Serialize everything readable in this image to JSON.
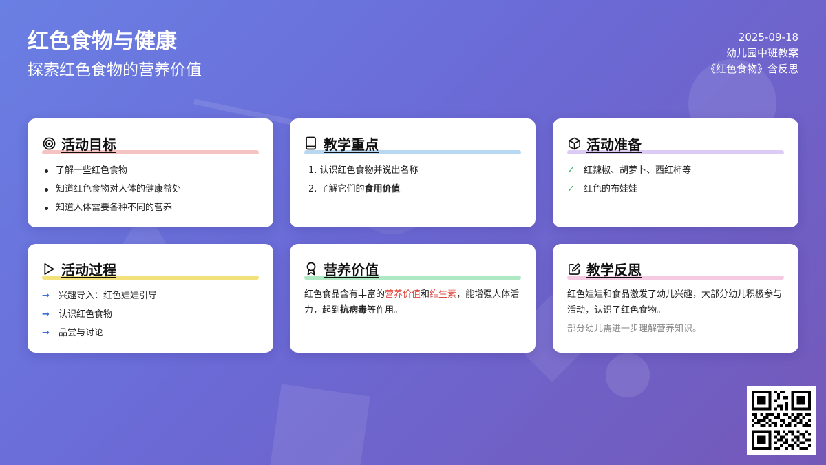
{
  "header": {
    "title": "红色食物与健康",
    "subtitle": "探索红色食物的营养价值",
    "date": "2025-09-18",
    "class_name": "幼儿园中班教案",
    "doc_name": "《红色食物》含反思"
  },
  "colors": {
    "bg_start": "#6a7fe3",
    "bg_end": "#7458b8",
    "highlight_red": "#f6c3c3",
    "highlight_blue": "#b8d7f0",
    "highlight_purple": "#dccbf4",
    "highlight_yellow": "#f3e27b",
    "highlight_green": "#aee9c4",
    "highlight_pink": "#f6c9e3",
    "link_red": "#e0483f"
  },
  "cards": {
    "goals": {
      "icon": "target-icon",
      "title": "活动目标",
      "items": [
        "了解一些红色食物",
        "知道红色食物对人体的健康益处",
        "知道人体需要各种不同的营养"
      ]
    },
    "focus": {
      "icon": "book-icon",
      "title": "教学重点",
      "item1": "1. 认识红色食物并说出名称",
      "item2_prefix": "2. 了解它们的",
      "item2_bold": "食用价值"
    },
    "prep": {
      "icon": "box-icon",
      "title": "活动准备",
      "items": [
        "红辣椒、胡萝卜、西红柿等",
        "红色的布娃娃"
      ]
    },
    "process": {
      "icon": "play-icon",
      "title": "活动过程",
      "items": [
        "兴趣导入：红色娃娃引导",
        "认识红色食物",
        "品尝与讨论"
      ]
    },
    "nutrition": {
      "icon": "award-icon",
      "title": "营养价值",
      "t1": "红色食品含有丰富的",
      "link1": "营养价值",
      "t2": "和",
      "link2": "维生素",
      "t3": "，能增强人体活力，起到",
      "bold": "抗病毒",
      "t4": "等作用。"
    },
    "reflection": {
      "icon": "edit-icon",
      "title": "教学反思",
      "text": "红色娃娃和食品激发了幼儿兴趣，大部分幼儿积极参与活动，认识了红色食物。",
      "note": "部分幼儿需进一步理解营养知识。"
    }
  }
}
